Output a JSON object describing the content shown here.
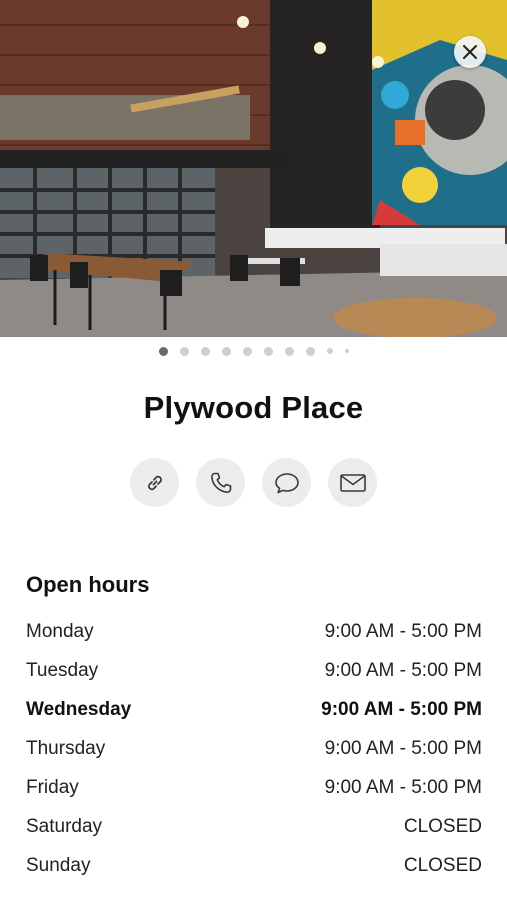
{
  "place": {
    "name": "Plywood Place"
  },
  "gallery": {
    "total": 10,
    "current": 1
  },
  "actions": [
    {
      "icon": "link-icon"
    },
    {
      "icon": "phone-icon"
    },
    {
      "icon": "message-icon"
    },
    {
      "icon": "mail-icon"
    }
  ],
  "hours": {
    "heading": "Open hours",
    "today": "Wednesday",
    "days": [
      {
        "day": "Monday",
        "time": "9:00 AM - 5:00 PM"
      },
      {
        "day": "Tuesday",
        "time": "9:00 AM - 5:00 PM"
      },
      {
        "day": "Wednesday",
        "time": "9:00 AM - 5:00 PM"
      },
      {
        "day": "Thursday",
        "time": "9:00 AM - 5:00 PM"
      },
      {
        "day": "Friday",
        "time": "9:00 AM - 5:00 PM"
      },
      {
        "day": "Saturday",
        "time": "CLOSED"
      },
      {
        "day": "Sunday",
        "time": "CLOSED"
      }
    ]
  }
}
